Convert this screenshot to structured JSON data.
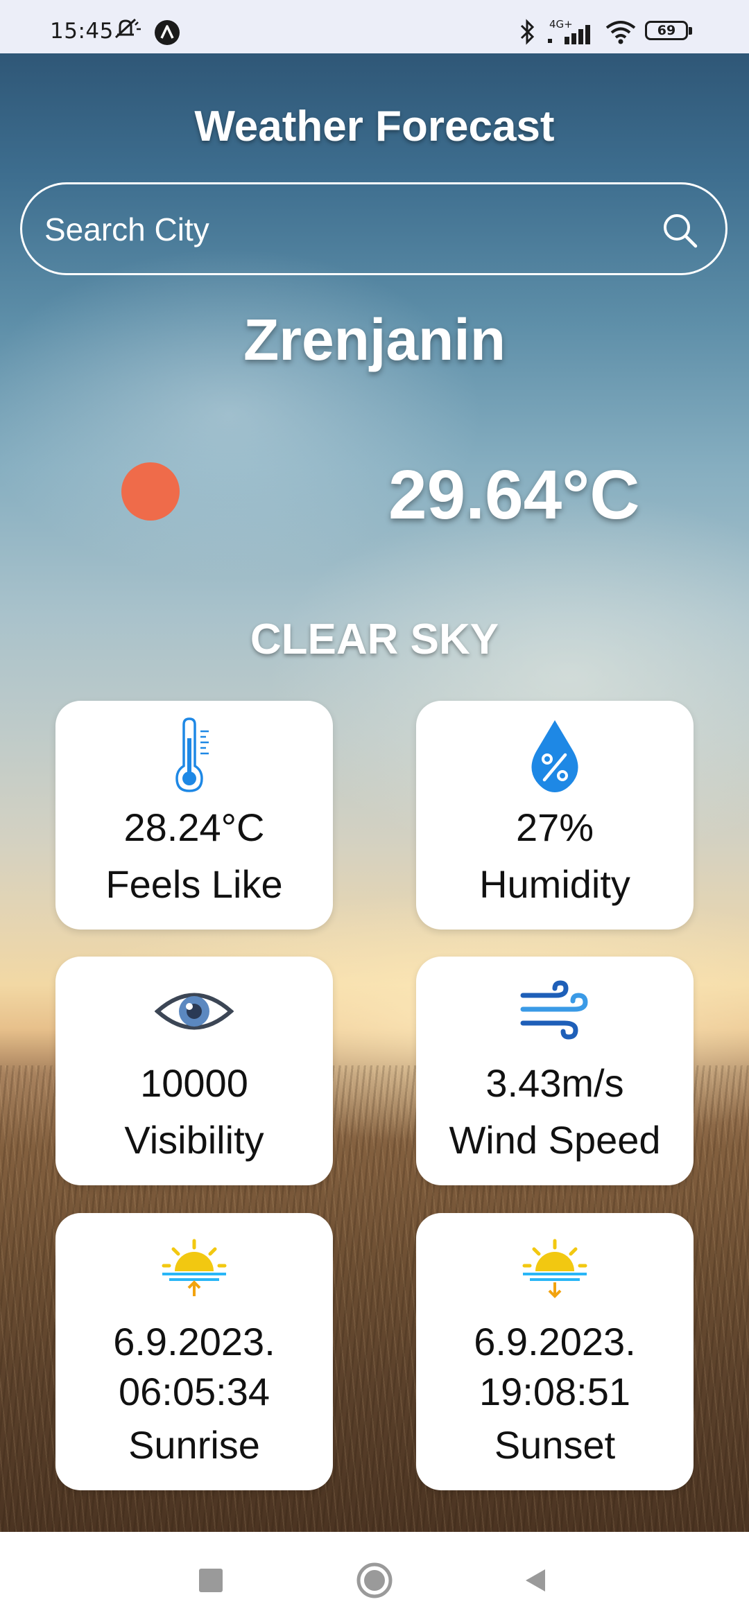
{
  "status_bar": {
    "time": "15:45",
    "network": "4G+",
    "battery": "69",
    "icons": [
      "mute-icon",
      "assistant-icon",
      "bluetooth-icon",
      "signal-icon",
      "wifi-icon",
      "battery-icon"
    ]
  },
  "header": {
    "title": "Weather Forecast"
  },
  "search": {
    "placeholder": "Search City",
    "value": ""
  },
  "current": {
    "city": "Zrenjanin",
    "temperature": "29.64°C",
    "condition": "CLEAR SKY",
    "icon": "sun-icon"
  },
  "cards": [
    {
      "icon": "thermometer-icon",
      "value": "28.24°C",
      "label": "Feels Like"
    },
    {
      "icon": "humidity-drop-icon",
      "value": "27%",
      "label": "Humidity"
    },
    {
      "icon": "eye-icon",
      "value": "10000",
      "label": "Visibility"
    },
    {
      "icon": "wind-icon",
      "value": "3.43m/s",
      "label": "Wind Speed"
    },
    {
      "icon": "sunrise-icon",
      "date": "6.9.2023.",
      "time": "06:05:34",
      "label": "Sunrise"
    },
    {
      "icon": "sunset-icon",
      "date": "6.9.2023.",
      "time": "19:08:51",
      "label": "Sunset"
    }
  ],
  "colors": {
    "accent_blue": "#1e88e5",
    "sun_orange": "#ef6b4a",
    "sun_yellow": "#f2c811",
    "card_bg": "#ffffff"
  },
  "nav": {
    "buttons": [
      "recents-button",
      "home-button",
      "back-button"
    ]
  }
}
